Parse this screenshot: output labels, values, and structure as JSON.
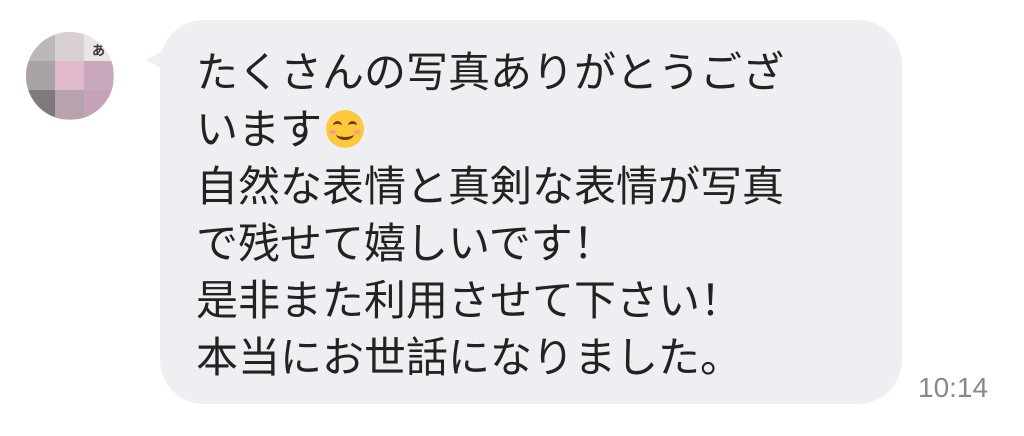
{
  "chat": {
    "sender": {
      "avatar_icon": "blurred-avatar-icon",
      "avatar_mark": "あ"
    },
    "message": {
      "line1": "たくさんの写真ありがとうござ",
      "line2": "います",
      "emoji": "smiling-face-icon",
      "line3": "自然な表情と真剣な表情が写真",
      "line4": "で残せて嬉しいです！",
      "line5": "是非また利用させて下さい！",
      "line6": "本当にお世話になりました。",
      "timestamp": "10:14"
    }
  },
  "colors": {
    "bubble": "#eeeff2",
    "text": "#222222",
    "timestamp": "#888888",
    "emoji_face": "#ffc83d"
  }
}
